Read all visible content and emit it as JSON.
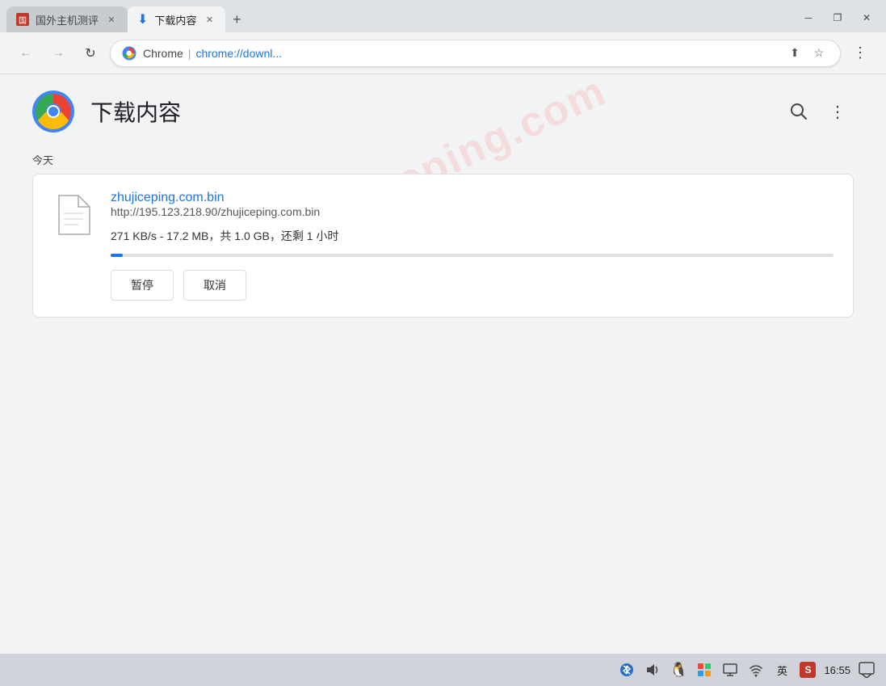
{
  "window": {
    "minimize_label": "─",
    "restore_label": "❐",
    "close_label": "✕"
  },
  "tabs": [
    {
      "id": "tab-1",
      "label": "国外主机测评",
      "active": false,
      "favicon_type": "image"
    },
    {
      "id": "tab-2",
      "label": "下载内容",
      "active": true,
      "favicon_type": "download"
    }
  ],
  "toolbar": {
    "brand": "Chrome",
    "separator": "|",
    "url": "chrome://downl...",
    "back_title": "后退",
    "forward_title": "前进",
    "reload_title": "重新加载页面",
    "share_label": "分享",
    "bookmark_label": "将此标签页加入书签"
  },
  "page": {
    "title": "下载内容",
    "section_today": "今天",
    "watermark": "zhujiceping.com",
    "search_label": "搜索",
    "more_label": "更多操作"
  },
  "download": {
    "filename": "zhujiceping.com.bin",
    "url": "http://195.123.218.90/zhujiceping.com.bin",
    "status": "271 KB/s - 17.2 MB，共 1.0 GB，还剩 1 小时",
    "progress_percent": 1.72,
    "pause_label": "暂停",
    "cancel_label": "取消"
  },
  "taskbar": {
    "bluetooth_icon": "🔵",
    "volume_icon": "🔊",
    "qq_icon": "🐧",
    "figma_icon": "🎨",
    "display_icon": "🖥",
    "wifi_icon": "📶",
    "lang_label": "英",
    "sougou_label": "S",
    "time": "16:55",
    "notify_icon": "💬"
  }
}
